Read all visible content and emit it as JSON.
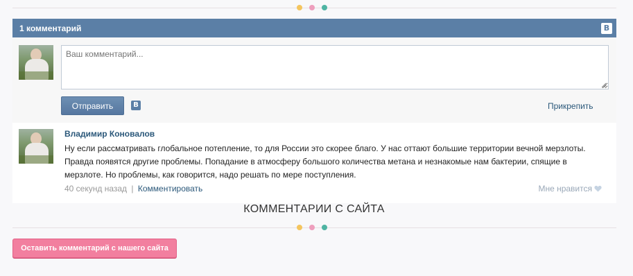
{
  "vk_widget": {
    "header_title": "1 комментарий",
    "header_logo": "В",
    "input_placeholder": "Ваш комментарий...",
    "send_label": "Отправить",
    "small_logo": "В",
    "attach_label": "Прикрепить"
  },
  "comment": {
    "author": "Владимир Коновалов",
    "text": "Ну если рассматривать глобальное потепление, то для России это скорее благо. У нас оттают большие территории вечной мерзлоты. Правда появятся другие проблемы. Попадание в атмосферу большого количества метана и незнакомые нам бактерии, спящие в мерзлоте. Но проблемы, как говорится, надо решать по мере поступления.",
    "time": "40 секунд назад",
    "separator": "|",
    "reply_label": "Комментировать",
    "like_label": "Мне нравится"
  },
  "site_section": {
    "title": "КОММЕНТАРИИ С САЙТА",
    "leave_comment_label": "Оставить комментарий с нашего сайта"
  },
  "colors": {
    "vk_header": "#5b7fa6",
    "link": "#2b587a",
    "accent_pink": "#f27f9f",
    "dot_yellow": "#f4c55e",
    "dot_pink": "#ee9ebd",
    "dot_green": "#4fb4a3"
  },
  "icons": [
    "vk-logo-icon",
    "heart-icon",
    "resize-grip-icon",
    "decorative-dots"
  ]
}
